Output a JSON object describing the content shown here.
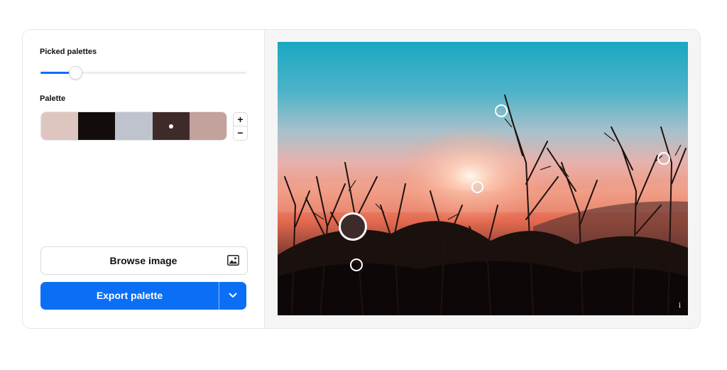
{
  "picked_palettes": {
    "label": "Picked palettes",
    "slider_value_fraction": 0.17
  },
  "palette": {
    "label": "Palette",
    "swatches": [
      {
        "color": "#dfc5c0",
        "selected": false
      },
      {
        "color": "#120c0b",
        "selected": false
      },
      {
        "color": "#bfc3cd",
        "selected": false
      },
      {
        "color": "#3f2a2a",
        "selected": true
      },
      {
        "color": "#c2a29b",
        "selected": false
      }
    ],
    "add_symbol": "+",
    "remove_symbol": "−"
  },
  "actions": {
    "browse_label": "Browse image",
    "export_label": "Export palette"
  },
  "image": {
    "info_symbol": "i"
  },
  "colors": {
    "accent": "#0b6ff6",
    "panel_background": "#f5f5f5",
    "selected_marker_fill": "#3f2a2a"
  }
}
